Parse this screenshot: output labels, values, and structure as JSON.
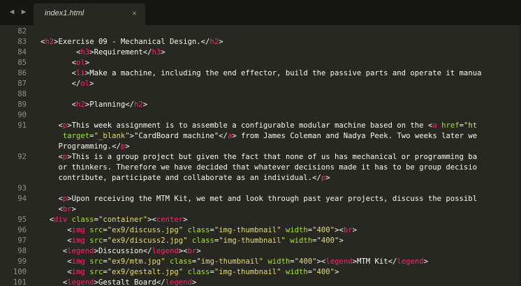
{
  "tabbar": {
    "back_icon": "◀",
    "forward_icon": "▶",
    "tab_title": "index1.html",
    "close_icon": "×"
  },
  "line_numbers": [
    "82",
    "83",
    "84",
    "85",
    "86",
    "87",
    "88",
    "89",
    "90",
    "91",
    "",
    "",
    "92",
    "",
    "",
    "93",
    "94",
    "",
    "95",
    "96",
    "97",
    "98",
    "99",
    "100",
    "101"
  ],
  "lines": [
    [],
    [
      [
        "p",
        "<"
      ],
      [
        "t",
        "h2"
      ],
      [
        "p",
        ">"
      ],
      [
        "p",
        "Exercise 09 - Mechanical Design."
      ],
      [
        "p",
        "</"
      ],
      [
        "t",
        "h2"
      ],
      [
        "p",
        ">"
      ]
    ],
    [
      [
        "p",
        "        <"
      ],
      [
        "t",
        "h3"
      ],
      [
        "p",
        ">"
      ],
      [
        "p",
        "Requirement"
      ],
      [
        "p",
        "</"
      ],
      [
        "t",
        "h3"
      ],
      [
        "p",
        ">"
      ]
    ],
    [
      [
        "p",
        "       <"
      ],
      [
        "t",
        "ol"
      ],
      [
        "p",
        ">"
      ]
    ],
    [
      [
        "p",
        "       <"
      ],
      [
        "t",
        "li"
      ],
      [
        "p",
        ">"
      ],
      [
        "p",
        "Make a machine, including the end effector, build the passive parts and operate it manua"
      ]
    ],
    [
      [
        "p",
        "       </"
      ],
      [
        "t",
        "ol"
      ],
      [
        "p",
        ">"
      ]
    ],
    [],
    [
      [
        "p",
        "       <"
      ],
      [
        "t",
        "h2"
      ],
      [
        "p",
        ">"
      ],
      [
        "p",
        "Planning"
      ],
      [
        "p",
        "</"
      ],
      [
        "t",
        "h2"
      ],
      [
        "p",
        ">"
      ]
    ],
    [],
    [
      [
        "p",
        "    <"
      ],
      [
        "t",
        "p"
      ],
      [
        "p",
        ">"
      ],
      [
        "p",
        "This week assignment is to assemble a configurable modular machine based on the "
      ],
      [
        "p",
        "<"
      ],
      [
        "t",
        "a"
      ],
      [
        "p",
        " "
      ],
      [
        "a",
        "href"
      ],
      [
        "p",
        "="
      ],
      [
        "s",
        "\"ht"
      ]
    ],
    [
      [
        "p",
        "     "
      ],
      [
        "a",
        "target"
      ],
      [
        "p",
        "="
      ],
      [
        "s",
        "\"_blank\""
      ],
      [
        "p",
        ">"
      ],
      [
        "p",
        "\"CardBoard machine\""
      ],
      [
        "p",
        "</"
      ],
      [
        "t",
        "a"
      ],
      [
        "p",
        ">"
      ],
      [
        "p",
        " from James Coleman and Nadya Peek. Two weeks later we"
      ]
    ],
    [
      [
        "p",
        "    Programming."
      ],
      [
        "p",
        "</"
      ],
      [
        "t",
        "p"
      ],
      [
        "p",
        ">"
      ]
    ],
    [
      [
        "p",
        "    <"
      ],
      [
        "t",
        "p"
      ],
      [
        "p",
        ">"
      ],
      [
        "p",
        "This is a group project but given the fact that none of us has mechanical or programming ba"
      ]
    ],
    [
      [
        "p",
        "    or thinkers. Therefore we have decided that whatever decisions made it has to be group decisio"
      ]
    ],
    [
      [
        "p",
        "    contribute, participate and collaborate as an individual."
      ],
      [
        "p",
        "</"
      ],
      [
        "t",
        "p"
      ],
      [
        "p",
        ">"
      ]
    ],
    [],
    [
      [
        "p",
        "    <"
      ],
      [
        "t",
        "p"
      ],
      [
        "p",
        ">"
      ],
      [
        "p",
        "Upon receiving the MTM Kit, we met and look through past year projects, discuss the possibl"
      ]
    ],
    [
      [
        "p",
        "    <"
      ],
      [
        "t",
        "br"
      ],
      [
        "p",
        ">"
      ]
    ],
    [
      [
        "p",
        "  <"
      ],
      [
        "t",
        "div"
      ],
      [
        "p",
        " "
      ],
      [
        "a",
        "class"
      ],
      [
        "p",
        "="
      ],
      [
        "s",
        "\"container\""
      ],
      [
        "p",
        "><"
      ],
      [
        "t",
        "center"
      ],
      [
        "p",
        ">"
      ]
    ],
    [
      [
        "p",
        "      <"
      ],
      [
        "t",
        "img"
      ],
      [
        "p",
        " "
      ],
      [
        "a",
        "src"
      ],
      [
        "p",
        "="
      ],
      [
        "s",
        "\"ex9/discuss.jpg\""
      ],
      [
        "p",
        " "
      ],
      [
        "a",
        "class"
      ],
      [
        "p",
        "="
      ],
      [
        "s",
        "\"img-thumbnail\""
      ],
      [
        "p",
        " "
      ],
      [
        "a",
        "width"
      ],
      [
        "p",
        "="
      ],
      [
        "s",
        "\"400\""
      ],
      [
        "p",
        "><"
      ],
      [
        "t",
        "br"
      ],
      [
        "p",
        ">"
      ]
    ],
    [
      [
        "p",
        "      <"
      ],
      [
        "t",
        "img"
      ],
      [
        "p",
        " "
      ],
      [
        "a",
        "src"
      ],
      [
        "p",
        "="
      ],
      [
        "s",
        "\"ex9/discuss2.jpg\""
      ],
      [
        "p",
        " "
      ],
      [
        "a",
        "class"
      ],
      [
        "p",
        "="
      ],
      [
        "s",
        "\"img-thumbnail\""
      ],
      [
        "p",
        " "
      ],
      [
        "a",
        "width"
      ],
      [
        "p",
        "="
      ],
      [
        "s",
        "\"400\""
      ],
      [
        "p",
        ">"
      ]
    ],
    [
      [
        "p",
        "     <"
      ],
      [
        "t",
        "legend"
      ],
      [
        "p",
        ">"
      ],
      [
        "p",
        "Discussion"
      ],
      [
        "p",
        "</"
      ],
      [
        "t",
        "legend"
      ],
      [
        "p",
        "><"
      ],
      [
        "t",
        "br"
      ],
      [
        "p",
        ">"
      ]
    ],
    [
      [
        "p",
        "      <"
      ],
      [
        "t",
        "img"
      ],
      [
        "p",
        " "
      ],
      [
        "a",
        "src"
      ],
      [
        "p",
        "="
      ],
      [
        "s",
        "\"ex9/mtm.jpg\""
      ],
      [
        "p",
        " "
      ],
      [
        "a",
        "class"
      ],
      [
        "p",
        "="
      ],
      [
        "s",
        "\"img-thumbnail\""
      ],
      [
        "p",
        " "
      ],
      [
        "a",
        "width"
      ],
      [
        "p",
        "="
      ],
      [
        "s",
        "\"400\""
      ],
      [
        "p",
        "><"
      ],
      [
        "t",
        "legend"
      ],
      [
        "p",
        ">"
      ],
      [
        "p",
        "MTM Kit"
      ],
      [
        "p",
        "</"
      ],
      [
        "t",
        "legend"
      ],
      [
        "p",
        ">"
      ]
    ],
    [
      [
        "p",
        "      <"
      ],
      [
        "t",
        "img"
      ],
      [
        "p",
        " "
      ],
      [
        "a",
        "src"
      ],
      [
        "p",
        "="
      ],
      [
        "s",
        "\"ex9/gestalt.jpg\""
      ],
      [
        "p",
        " "
      ],
      [
        "a",
        "class"
      ],
      [
        "p",
        "="
      ],
      [
        "s",
        "\"img-thumbnail\""
      ],
      [
        "p",
        " "
      ],
      [
        "a",
        "width"
      ],
      [
        "p",
        "="
      ],
      [
        "s",
        "\"400\""
      ],
      [
        "p",
        ">"
      ]
    ],
    [
      [
        "p",
        "     <"
      ],
      [
        "t",
        "legend"
      ],
      [
        "p",
        ">"
      ],
      [
        "p",
        "Gestalt Board"
      ],
      [
        "p",
        "</"
      ],
      [
        "t",
        "legend"
      ],
      [
        "p",
        ">"
      ]
    ]
  ]
}
